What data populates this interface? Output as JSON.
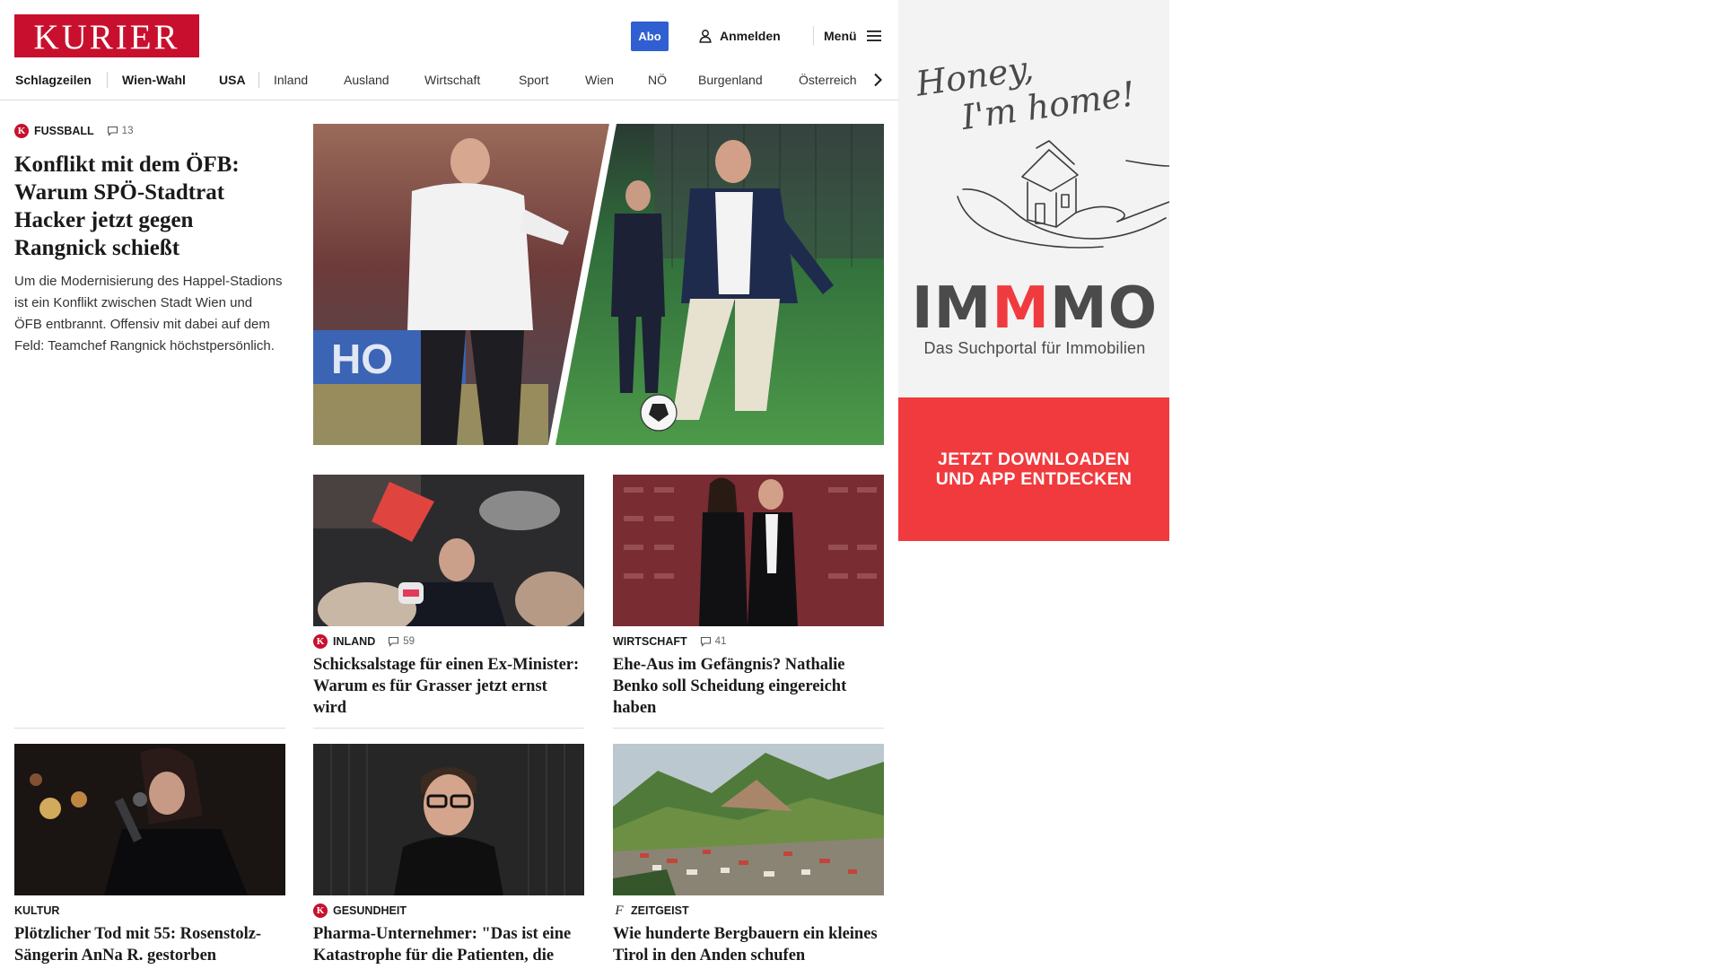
{
  "header": {
    "logo_text": "KURIER",
    "abo_label": "Abo",
    "login_label": "Anmelden",
    "menu_label": "Menü"
  },
  "nav": {
    "items": [
      "Schlagzeilen",
      "Wien-Wahl",
      "USA",
      "Inland",
      "Ausland",
      "Wirtschaft",
      "Sport",
      "Wien",
      "NÖ",
      "Burgenland",
      "Österreich"
    ]
  },
  "lead": {
    "badge": "K",
    "category": "FUSSBALL",
    "comments": "13",
    "title": "Konflikt mit dem ÖFB: Warum SPÖ-Stadtrat Hacker jetzt gegen Rangnick schießt",
    "teaser": "Um die Modernisierung des Happel-Stadions ist ein Konflikt zwischen Stadt Wien und ÖFB entbrannt. Offensiv mit dabei auf dem Feld: Teamchef Rangnick höchstpersönlich."
  },
  "cards": [
    {
      "badge": "K",
      "category": "INLAND",
      "comments": "59",
      "title": "Schicksalstage für einen Ex-Minister: Warum es für Grasser jetzt ernst wird"
    },
    {
      "badge": "",
      "category": "WIRTSCHAFT",
      "comments": "41",
      "title": "Ehe-Aus im Gefängnis? Nathalie Benko soll Scheidung eingereicht haben"
    },
    {
      "badge": "",
      "category": "KULTUR",
      "comments": "",
      "title": "Plötzlicher Tod mit 55: Rosenstolz-Sängerin AnNa R. gestorben"
    },
    {
      "badge": "K",
      "category": "GESUNDHEIT",
      "comments": "",
      "title": "Pharma-Unternehmer: \"Das ist eine Katastrophe für die Patienten, die leiden\""
    },
    {
      "badge": "f",
      "category": "ZEITGEIST",
      "comments": "",
      "title": "Wie hunderte Bergbauern ein kleines Tirol in den Anden schufen"
    }
  ],
  "ad": {
    "script_line1": "Honey,",
    "script_line2": "I'm home!",
    "brand": "IMMMO",
    "tagline": "Das Suchportal für Immobilien",
    "cta_line1": "JETZT DOWNLOADEN",
    "cta_line2": "UND APP ENTDECKEN"
  },
  "colors": {
    "brand_red": "#c8102e",
    "abo_blue": "#2f5fd0",
    "ad_red": "#f03a3d"
  },
  "icons": [
    "user-icon",
    "hamburger-icon",
    "chevron-right-icon",
    "comment-icon",
    "k-badge-icon",
    "f-badge-icon",
    "house-hand-illustration"
  ]
}
